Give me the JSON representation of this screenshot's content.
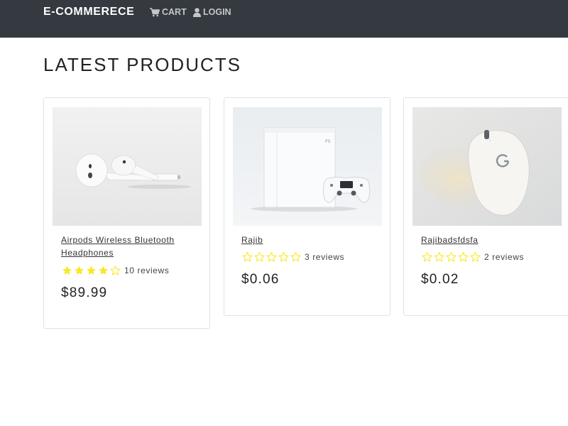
{
  "navbar": {
    "brand": "E-COMMERECE",
    "cart_label": "CART",
    "login_label": "LOGIN"
  },
  "page": {
    "title": "LATEST PRODUCTS"
  },
  "colors": {
    "navbar_bg": "#343a40",
    "star": "#f8e825"
  },
  "products": [
    {
      "name": "Airpods Wireless Bluetooth Headphones",
      "rating": 4,
      "reviews": "10 reviews",
      "price": "$89.99",
      "image": "airpods"
    },
    {
      "name": "Rajib",
      "rating": 0,
      "reviews": "3 reviews",
      "price": "$0.06",
      "image": "playstation-console"
    },
    {
      "name": "Rajibadsfdsfa",
      "rating": 0,
      "reviews": "2 reviews",
      "price": "$0.02",
      "image": "logitech-mouse"
    }
  ]
}
